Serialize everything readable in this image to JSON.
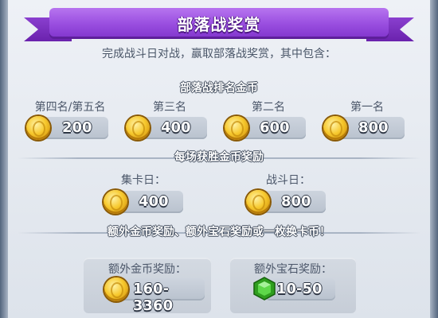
{
  "banner": {
    "title": "部落战奖赏"
  },
  "description": "完成战斗日对战，赢取部落战奖赏，其中包含：",
  "ranking": {
    "title": "部落战排名金币",
    "tiers": [
      {
        "label": "第四名/第五名",
        "value": "200"
      },
      {
        "label": "第三名",
        "value": "400"
      },
      {
        "label": "第二名",
        "value": "600"
      },
      {
        "label": "第一名",
        "value": "800"
      }
    ]
  },
  "per_win": {
    "title": "每场获胜金币奖励",
    "items": [
      {
        "label": "集卡日：",
        "value": "400"
      },
      {
        "label": "战斗日：",
        "value": "800"
      }
    ]
  },
  "bonus": {
    "title": "额外金币奖励、额外宝石奖励或一枚换卡币！",
    "gold": {
      "label": "额外金币奖励：",
      "value": "160-3360"
    },
    "gems": {
      "label": "额外宝石奖励：",
      "value": "10-50"
    }
  },
  "icons": {
    "coin": "gold-coin-icon",
    "gem": "green-gem-icon"
  },
  "colors": {
    "banner": "#9a4fe0",
    "coin": "#f7c92e",
    "gem": "#3fbf2a"
  }
}
